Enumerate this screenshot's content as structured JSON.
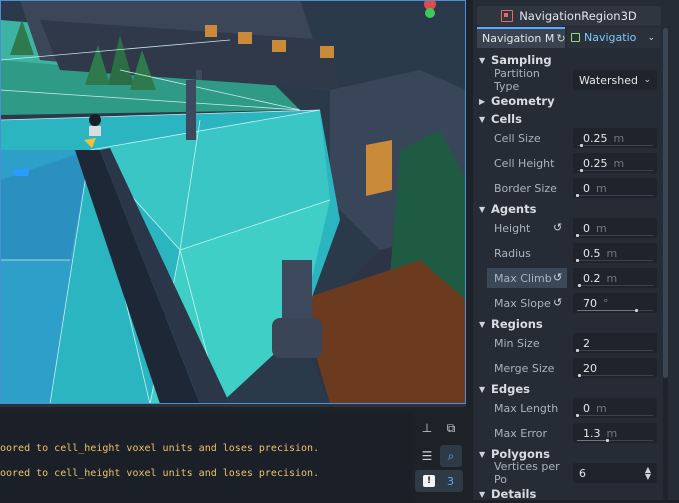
{
  "inspector": {
    "node_name": "NavigationRegion3D",
    "node_icon": "navigation-region-3d-icon",
    "tabs": [
      {
        "label": "Navigation M",
        "icon": "reload-icon"
      },
      {
        "label": "Navigatio",
        "icon": "navigation-mesh-icon"
      }
    ],
    "sections": {
      "sampling": "Sampling",
      "geometry": "Geometry",
      "cells": "Cells",
      "agents": "Agents",
      "regions": "Regions",
      "edges": "Edges",
      "polygons": "Polygons",
      "details": "Details"
    },
    "props": {
      "partition_type": {
        "label": "Partition Type",
        "value": "Watershed"
      },
      "cell_size": {
        "label": "Cell Size",
        "value": "0.25",
        "unit": "m",
        "slider": 0.05
      },
      "cell_height": {
        "label": "Cell Height",
        "value": "0.25",
        "unit": "m",
        "slider": 0.05
      },
      "border_size": {
        "label": "Border Size",
        "value": "0",
        "unit": "m",
        "slider": 0.0
      },
      "height": {
        "label": "Height",
        "value": "0",
        "unit": "m",
        "slider": 0.0
      },
      "radius": {
        "label": "Radius",
        "value": "0.5",
        "unit": "m",
        "slider": 0.0
      },
      "max_climb": {
        "label": "Max Climb",
        "value": "0.2",
        "unit": "m",
        "slider": 0.02
      },
      "max_slope": {
        "label": "Max Slope",
        "value": "70",
        "unit": "°",
        "slider": 0.78
      },
      "min_size": {
        "label": "Min Size",
        "value": "2",
        "slider": 0.0
      },
      "merge_size": {
        "label": "Merge Size",
        "value": "20",
        "slider": 0.02
      },
      "max_length": {
        "label": "Max Length",
        "value": "0",
        "unit": "m",
        "slider": 0.0
      },
      "max_error": {
        "label": "Max Error",
        "value": "1.3",
        "unit": "m",
        "slider": 0.4
      },
      "vertices_per_poly": {
        "label": "Vertices per Po",
        "value": "6"
      }
    }
  },
  "output": {
    "lines": [
      "oored to cell_height voxel units and loses precision.",
      "oored to cell_height voxel units and loses precision."
    ],
    "warning_count": "3"
  },
  "colors": {
    "accent": "#5fa8ff",
    "warning_text": "#e9c46a",
    "navmesh": "#3fd0d8"
  }
}
